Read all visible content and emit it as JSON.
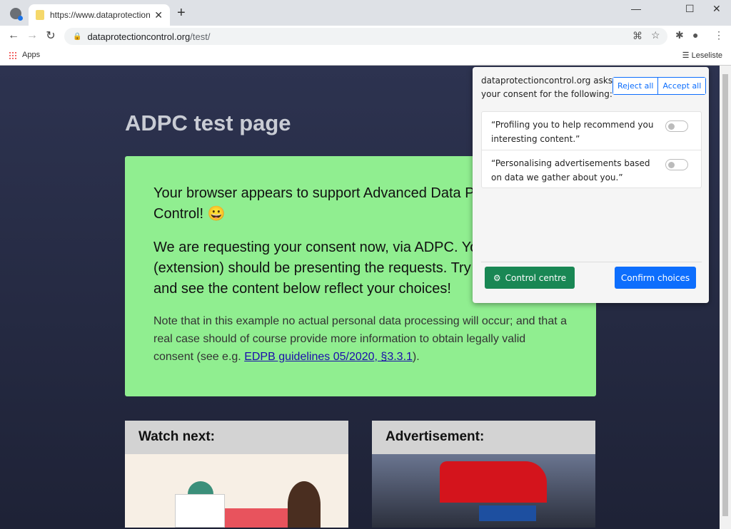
{
  "browser": {
    "tab_title": "https://www.dataprotectioncontrol.org/test/",
    "url_host": "dataprotectioncontrol.org",
    "url_path": "/test/",
    "bookmark_apps": "Apps",
    "reading_list": "Leseliste"
  },
  "page": {
    "title": "ADPC test page",
    "para1": "Your browser appears to support Advanced Data Protection Control! 😀",
    "para2": "We are requesting your consent now, via ADPC. Your browser (extension) should be presenting the requests. Try answering, and see the content below reflect your choices!",
    "note_before": "Note that in this example no actual personal data processing will occur; and that a real case should of course provide more information to obtain legally valid consent (see e.g. ",
    "note_link": "EDPB guidelines 05/2020, §3.3.1",
    "note_after": ").",
    "card1_title": "Watch next:",
    "card2_title": "Advertisement:"
  },
  "popup": {
    "ask": "dataprotectioncontrol.org asks your consent for the following:",
    "reject_all": "Reject all",
    "accept_all": "Accept all",
    "requests": [
      {
        "text": "“Profiling you to help recommend you interesting content.”",
        "enabled": false
      },
      {
        "text": "“Personalising advertisements based on data we gather about you.”",
        "enabled": false
      }
    ],
    "control_centre": "Control centre",
    "confirm": "Confirm choices"
  }
}
